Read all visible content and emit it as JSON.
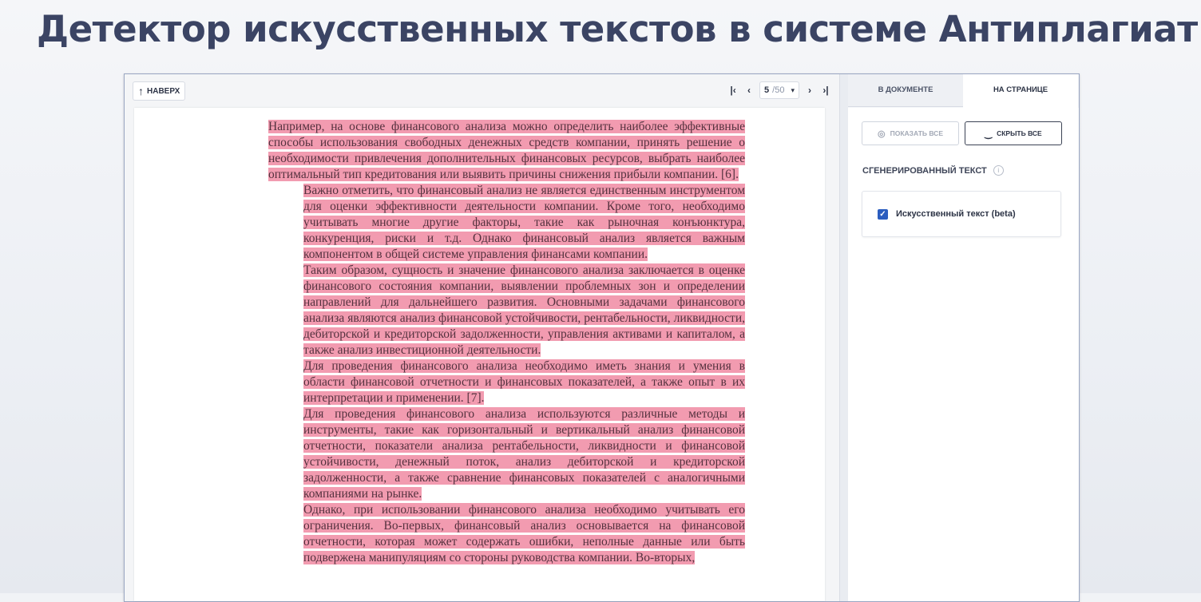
{
  "slide": {
    "title": "Детектор искусственных текстов в системе Антиплагиат"
  },
  "toolbar": {
    "up_label": "НАВЕРХ",
    "page_current": "5",
    "page_total": "/50",
    "first_icon": "first-page-icon",
    "prev_icon": "prev-page-icon",
    "next_icon": "next-page-icon",
    "last_icon": "last-page-icon"
  },
  "document": {
    "paragraphs": [
      "Например, на основе финансового анализа можно определить наиболее эффективные способы использования свободных денежных средств компании, принять решение о необходимости привлечения дополнительных финансовых ресурсов, выбрать наиболее оптимальный тип кредитования или выявить причины снижения прибыли компании. [6].",
      "Важно отметить, что финансовый анализ не является единственным инструментом для оценки эффективности деятельности компании. Кроме того, необходимо учитывать многие другие факторы, такие как рыночная конъюнктура, конкуренция, риски и т.д. Однако финансовый анализ является важным компонентом в общей системе управления финансами компании.",
      "Таким образом, сущность и значение финансового анализа заключается в оценке финансового состояния компании, выявлении проблемных зон и определении направлений для дальнейшего развития. Основными задачами финансового анализа являются анализ финансовой устойчивости, рентабельности, ликвидности, дебиторской и кредиторской задолженности, управления активами и капиталом, а также анализ инвестиционной деятельности.",
      "Для проведения финансового анализа необходимо иметь знания и умения в области финансовой отчетности и финансовых показателей, а также опыт в их интерпретации и применении. [7].",
      "Для проведения финансового анализа используются различные методы и инструменты, такие как горизонтальный и вертикальный анализ финансовой отчетности, показатели анализа рентабельности, ликвидности и финансовой устойчивости, денежный поток, анализ дебиторской и кредиторской задолженности, а также сравнение финансовых показателей с аналогичными компаниями на рынке.",
      "Однако, при использовании финансового анализа необходимо учитывать его ограничения. Во-первых, финансовый анализ основывается на финансовой отчетности, которая может содержать ошибки, неполные данные или быть подвержена манипуляциям со стороны руководства компании. Во-вторых,"
    ],
    "highlight_color": "#f29bb0"
  },
  "sidebar": {
    "tabs": [
      {
        "label": "В ДОКУМЕНТЕ",
        "active": false
      },
      {
        "label": "НА СТРАНИЦЕ",
        "active": true
      }
    ],
    "show_all_label": "ПОКАЗАТЬ ВСЕ",
    "hide_all_label": "СКРЫТЬ ВСЕ",
    "section_title": "СГЕНЕРИРОВАННЫЙ ТЕКСТ",
    "info_icon": "i",
    "checkbox_label": "Искусственный текст (beta)",
    "checkbox_checked": true
  }
}
